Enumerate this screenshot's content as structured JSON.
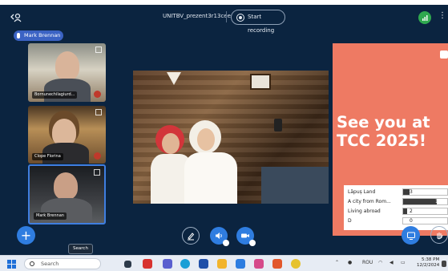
{
  "header": {
    "back_icon": "person-back-icon",
    "meeting_title": "UNITBV_prezent3r13cee",
    "record_label": "Start recording"
  },
  "presenter": {
    "name": "Mark Brennan"
  },
  "participants": [
    {
      "label": "Bornunechilagiurd..."
    },
    {
      "label": "Clope Florina"
    },
    {
      "label": "Mark Brennan"
    }
  ],
  "slide": {
    "heading": "See you at TCC 2025!",
    "background": "#ee7a63"
  },
  "poll": {
    "rows": [
      {
        "question": "Lăpuș Land",
        "count": "3",
        "fraction": 0.14,
        "percent": "14%"
      },
      {
        "question": "A city from Rom...",
        "count": "17",
        "fraction": 0.77,
        "percent": "77%"
      },
      {
        "question": "Living abroad",
        "count": "2",
        "fraction": 0.09,
        "percent": "9%"
      },
      {
        "question": "D",
        "count": "0",
        "fraction": 0.0,
        "percent": "0%"
      }
    ]
  },
  "toolbar": {
    "tooltip": "Search"
  },
  "taskbar": {
    "search_placeholder": "Search",
    "language": "ROU",
    "time": "5:38 PM",
    "date": "12/2/2024"
  },
  "colors": {
    "accent": "#2f7de0",
    "app_bg": "#0b2440",
    "recording_dot": "#e8eef5"
  }
}
